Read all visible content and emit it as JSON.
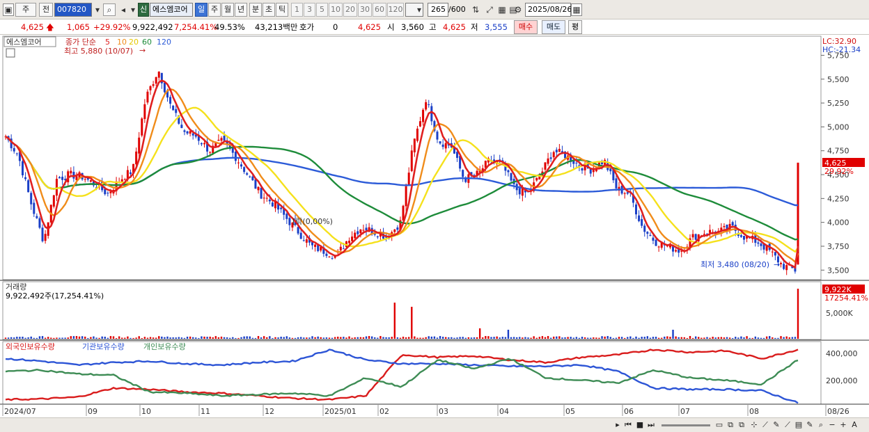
{
  "toolbar": {
    "period_type": "주",
    "prev_label": "전",
    "code": "007820",
    "stock_name": "에스엠코어",
    "badge_new": "신",
    "periods": [
      "일",
      "주",
      "월",
      "년",
      "분",
      "초",
      "틱"
    ],
    "active_period": "일",
    "nums": [
      "1",
      "3",
      "5",
      "10",
      "20",
      "30",
      "60",
      "120"
    ],
    "count": "265",
    "count_total": "/600",
    "date": "2025/08/26"
  },
  "quote": {
    "price": "4,625",
    "change": "1,065",
    "change_pct": "+29.92%",
    "volume": "9,922,492",
    "vol_pct": "7,254.41%",
    "turnover": "49.53%",
    "amount": "43,213백만",
    "hoga_label": "호가",
    "hoga_value": "0",
    "hoga_price": "4,625",
    "open_label": "시",
    "open": "3,560",
    "high_label": "고",
    "high": "4,625",
    "low_label": "저",
    "low": "3,555",
    "buy": "매수",
    "sell": "매도",
    "avg": "평"
  },
  "price_panel": {
    "legend_name": "에스엠코어",
    "legend_ma": "종가 단순",
    "ma_periods": [
      "5",
      "10",
      "20",
      "60",
      "120"
    ],
    "high_label": "최고 5,880 (10/07)",
    "low_label": "최저 3,480 (08/20)",
    "lc": "LC:32.90",
    "hc": "HC:-21.34",
    "cur_price": "4,625",
    "cur_pct": "29.92%",
    "note": "[락(0,00%)",
    "y_ticks": [
      "5,750",
      "5,500",
      "5,250",
      "5,000",
      "4,750",
      "4,500",
      "4,250",
      "4,000",
      "3,750",
      "3,500"
    ]
  },
  "volume_panel": {
    "title": "거래량",
    "value": "9,922,492주(17,254.41%)",
    "tick": "5,000K",
    "cur": "9,922K",
    "cur_pct": "17254.41%"
  },
  "holding_panel": {
    "legends": [
      "외국인보유수량",
      "기관보유수량",
      "개인보유수량"
    ],
    "ticks": [
      "400,000",
      "200,000"
    ]
  },
  "x_ticks": [
    "2024/07",
    "09",
    "10",
    "11",
    "12",
    "2025/01",
    "02",
    "03",
    "04",
    "05",
    "06",
    "07",
    "08",
    "08/26"
  ],
  "colors": {
    "up": "#e00000",
    "down": "#1a3fc7",
    "ma5": "#e02020",
    "ma10": "#f08c1a",
    "ma20": "#f5e11c",
    "ma60": "#1e8c3a",
    "ma120": "#2c5bd8",
    "foreign": "#d91c1c",
    "institution": "#2d55d6",
    "individual": "#3e8c55"
  },
  "chart_data": {
    "type": "candlestick",
    "x_range": [
      "2024/07",
      "2025/08/26"
    ],
    "ylim": [
      3400,
      5950
    ],
    "high": {
      "value": 5880,
      "date": "10/07"
    },
    "low": {
      "value": 3480,
      "date": "08/20"
    },
    "last": {
      "open": 3560,
      "high": 4625,
      "low": 3555,
      "close": 4625
    },
    "close_trend": [
      4900,
      4700,
      4200,
      3800,
      4450,
      4500,
      4480,
      4400,
      4300,
      4450,
      4550,
      5300,
      5600,
      5200,
      4950,
      4900,
      4750,
      4850,
      4700,
      4500,
      4300,
      4200,
      4050,
      3900,
      3750,
      3700,
      3650,
      3850,
      3950,
      3900,
      3850,
      4000,
      4800,
      5300,
      4850,
      4800,
      4450,
      4500,
      4650,
      4600,
      4350,
      4300,
      4500,
      4750,
      4700,
      4600,
      4550,
      4650,
      4350,
      4300,
      3950,
      3800,
      3750,
      3700,
      3850,
      3900,
      3900,
      3950,
      3850,
      3800,
      3700,
      3550,
      3500,
      4625
    ]
  }
}
